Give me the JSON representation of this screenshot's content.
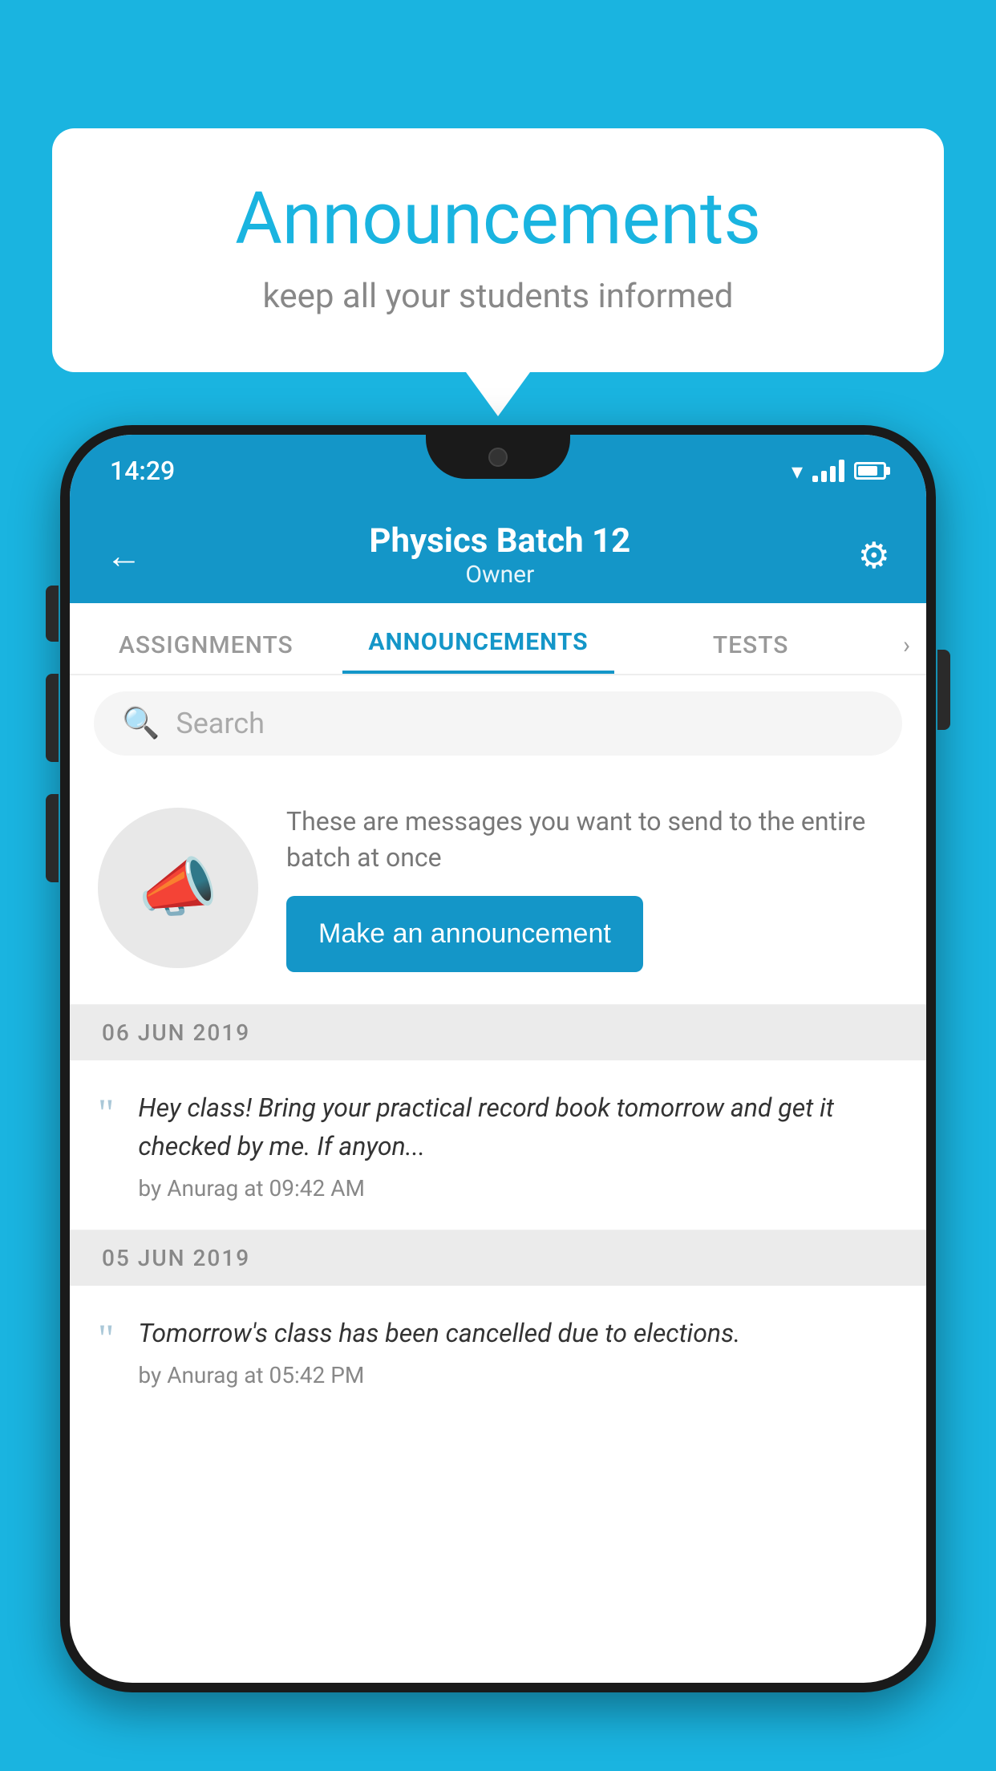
{
  "background_color": "#1ab4e0",
  "speech_bubble": {
    "title": "Announcements",
    "subtitle": "keep all your students informed"
  },
  "phone": {
    "status_bar": {
      "time": "14:29"
    },
    "header": {
      "title": "Physics Batch 12",
      "subtitle": "Owner",
      "back_label": "←",
      "gear_label": "⚙"
    },
    "tabs": [
      {
        "label": "ASSIGNMENTS",
        "active": false
      },
      {
        "label": "ANNOUNCEMENTS",
        "active": true
      },
      {
        "label": "TESTS",
        "active": false
      }
    ],
    "search": {
      "placeholder": "Search"
    },
    "announcement_prompt": {
      "description": "These are messages you want to send to the entire batch at once",
      "button_label": "Make an announcement"
    },
    "announcements": [
      {
        "date": "06  JUN  2019",
        "text": "Hey class! Bring your practical record book tomorrow and get it checked by me. If anyon...",
        "meta": "by Anurag at 09:42 AM"
      },
      {
        "date": "05  JUN  2019",
        "text": "Tomorrow's class has been cancelled due to elections.",
        "meta": "by Anurag at 05:42 PM"
      }
    ]
  }
}
